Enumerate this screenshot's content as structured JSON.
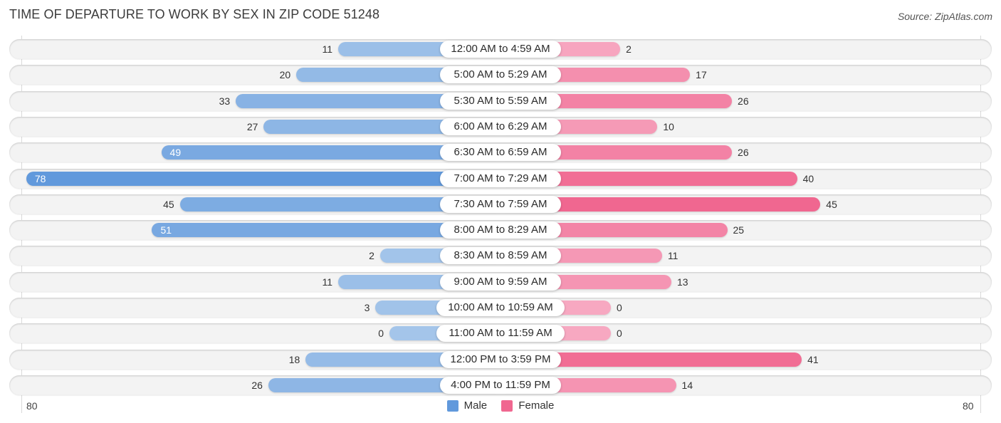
{
  "header": {
    "title": "TIME OF DEPARTURE TO WORK BY SEX IN ZIP CODE 51248",
    "source": "Source: ZipAtlas.com"
  },
  "colors": {
    "male_strong": "#6199dc",
    "male_light": "#a4c5ea",
    "female_strong": "#f06790",
    "female_light": "#f7a8c1"
  },
  "chart_data": {
    "type": "bar",
    "orientation": "horizontal-diverging",
    "title": "TIME OF DEPARTURE TO WORK BY SEX IN ZIP CODE 51248",
    "categories": [
      "12:00 AM to 4:59 AM",
      "5:00 AM to 5:29 AM",
      "5:30 AM to 5:59 AM",
      "6:00 AM to 6:29 AM",
      "6:30 AM to 6:59 AM",
      "7:00 AM to 7:29 AM",
      "7:30 AM to 7:59 AM",
      "8:00 AM to 8:29 AM",
      "8:30 AM to 8:59 AM",
      "9:00 AM to 9:59 AM",
      "10:00 AM to 10:59 AM",
      "11:00 AM to 11:59 AM",
      "12:00 PM to 3:59 PM",
      "4:00 PM to 11:59 PM"
    ],
    "series": [
      {
        "name": "Male",
        "values": [
          11,
          20,
          33,
          27,
          49,
          78,
          45,
          51,
          2,
          11,
          3,
          0,
          18,
          26
        ]
      },
      {
        "name": "Female",
        "values": [
          2,
          17,
          26,
          10,
          26,
          40,
          45,
          25,
          11,
          13,
          0,
          0,
          41,
          14
        ]
      }
    ],
    "axis": {
      "left_max_label": "80",
      "right_max_label": "80",
      "max": 80
    },
    "legend": {
      "position": "bottom-center",
      "entries": [
        "Male",
        "Female"
      ]
    },
    "grid": false
  }
}
